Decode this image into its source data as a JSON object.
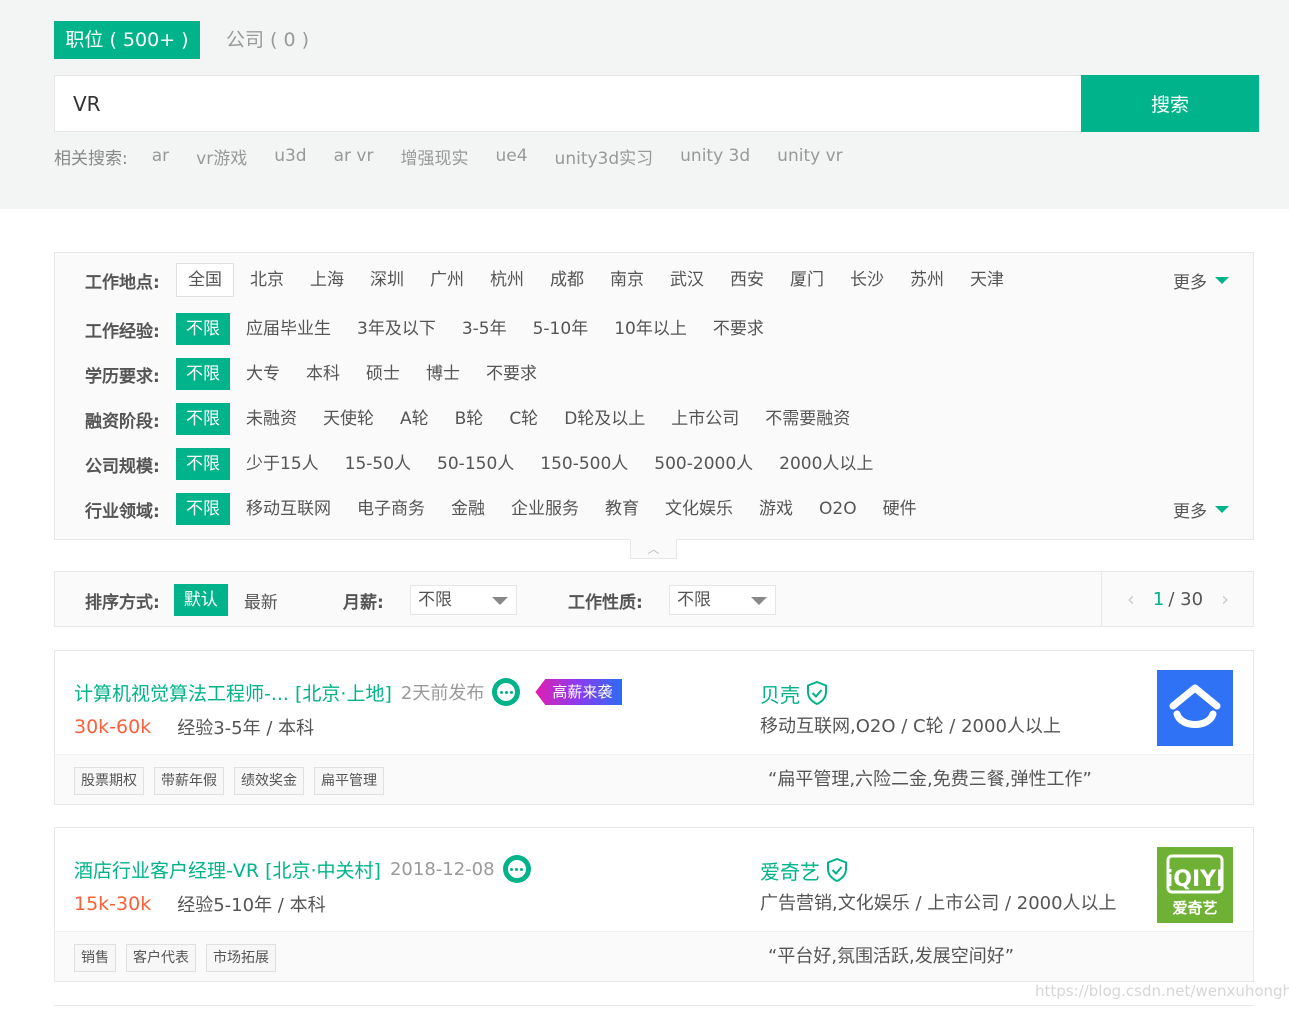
{
  "tabs": {
    "positions": "职位 ( 500+ )",
    "companies": "公司 ( 0 )"
  },
  "search": {
    "value": "VR",
    "button": "搜索"
  },
  "related": {
    "label": "相关搜索:",
    "items": [
      "ar",
      "vr游戏",
      "u3d",
      "ar vr",
      "增强现实",
      "ue4",
      "unity3d实习",
      "unity 3d",
      "unity vr"
    ]
  },
  "filters": {
    "location": {
      "label": "工作地点:",
      "options": [
        "全国",
        "北京",
        "上海",
        "深圳",
        "广州",
        "杭州",
        "成都",
        "南京",
        "武汉",
        "西安",
        "厦门",
        "长沙",
        "苏州",
        "天津"
      ],
      "more": "更多"
    },
    "experience": {
      "label": "工作经验:",
      "options": [
        "不限",
        "应届毕业生",
        "3年及以下",
        "3-5年",
        "5-10年",
        "10年以上",
        "不要求"
      ]
    },
    "education": {
      "label": "学历要求:",
      "options": [
        "不限",
        "大专",
        "本科",
        "硕士",
        "博士",
        "不要求"
      ]
    },
    "financing": {
      "label": "融资阶段:",
      "options": [
        "不限",
        "未融资",
        "天使轮",
        "A轮",
        "B轮",
        "C轮",
        "D轮及以上",
        "上市公司",
        "不需要融资"
      ]
    },
    "size": {
      "label": "公司规模:",
      "options": [
        "不限",
        "少于15人",
        "15-50人",
        "50-150人",
        "150-500人",
        "500-2000人",
        "2000人以上"
      ]
    },
    "industry": {
      "label": "行业领域:",
      "options": [
        "不限",
        "移动互联网",
        "电子商务",
        "金融",
        "企业服务",
        "教育",
        "文化娱乐",
        "游戏",
        "O2O",
        "硬件"
      ],
      "more": "更多"
    }
  },
  "sort": {
    "label": "排序方式:",
    "default": "默认",
    "newest": "最新",
    "salary_label": "月薪:",
    "salary_value": "不限",
    "jobtype_label": "工作性质:",
    "jobtype_value": "不限",
    "page_current": "1",
    "page_total": " / 30"
  },
  "jobs": [
    {
      "title": "计算机视觉算法工程师-... [北京·上地]",
      "date": "2天前发布",
      "badge": "高薪来袭",
      "salary": "30k-60k",
      "requirements": "经验3-5年 / 本科",
      "company": "贝壳",
      "industry": "移动互联网,O2O / C轮 / 2000人以上",
      "tags": [
        "股票期权",
        "带薪年假",
        "绩效奖金",
        "扁平管理"
      ],
      "welfare": "“扁平管理,六险二金,免费三餐,弹性工作”"
    },
    {
      "title": "酒店行业客户经理-VR [北京·中关村]",
      "date": "2018-12-08",
      "salary": "15k-30k",
      "requirements": "经验5-10年 / 本科",
      "company": "爱奇艺",
      "industry": "广告营销,文化娱乐 / 上市公司 / 2000人以上",
      "tags": [
        "销售",
        "客户代表",
        "市场拓展"
      ],
      "welfare": "“平台好,氛围活跃,发展空间好”",
      "logo_text_top": "iQIYI",
      "logo_text_bottom": "爱奇艺"
    }
  ],
  "colors": {
    "brand": "#00b38a",
    "salary": "#fd5f39",
    "beike_logo": "#3072f6",
    "iqiyi_logo": "#6eb134"
  },
  "watermark": "https://blog.csdn.net/wenxuhonghe"
}
